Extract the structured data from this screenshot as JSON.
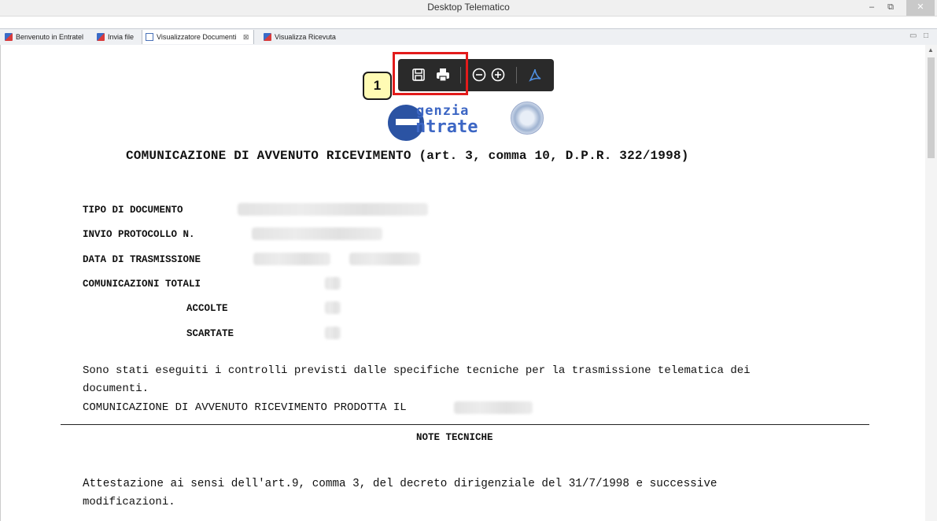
{
  "window": {
    "title": "Desktop Telematico",
    "controls": {
      "minimize": "–",
      "restore": "⧉",
      "close": "✕"
    }
  },
  "tabs": [
    {
      "label": "Benvenuto in Entratel",
      "icon": "entratel-icon"
    },
    {
      "label": "Invia file",
      "icon": "entratel-icon"
    },
    {
      "label": "Visualizzatore Documenti",
      "icon": "document-viewer-icon",
      "active": true,
      "close": "⊠"
    },
    {
      "label": "Visualizza Ricevuta",
      "icon": "entratel-icon"
    }
  ],
  "pdf_toolbar": {
    "buttons": [
      "save-icon",
      "print-icon",
      "zoom-out-icon",
      "zoom-in-icon",
      "adobe-acrobat-icon"
    ],
    "callout_number": "1",
    "highlight_color": "#e21b1b"
  },
  "logo": {
    "line1": "genzia",
    "line2": "ntrate",
    "brand_color": "#3c66c4"
  },
  "document": {
    "title": "COMUNICAZIONE DI AVVENUTO RICEVIMENTO (art. 3, comma 10, D.P.R. 322/1998)",
    "fields": {
      "tipo": "TIPO DI DOCUMENTO",
      "protocollo": "INVIO PROTOCOLLO  N.",
      "data": "DATA DI TRASMISSIONE",
      "totali": "COMUNICAZIONI TOTALI",
      "accolte": "ACCOLTE",
      "scartate": "SCARTATE"
    },
    "paragraph_line1": "Sono stati eseguiti i controlli previsti dalle specifiche tecniche per la trasmissione telematica dei",
    "paragraph_line2": "documenti.",
    "produced_line": "COMUNICAZIONE DI AVVENUTO RICEVIMENTO PRODOTTA IL",
    "notes_heading": "NOTE TECNICHE",
    "attestation_line1": "Attestazione ai sensi dell'art.9, comma 3, del decreto dirigenziale del 31/7/1998 e successive",
    "attestation_line2": "modificazioni."
  }
}
